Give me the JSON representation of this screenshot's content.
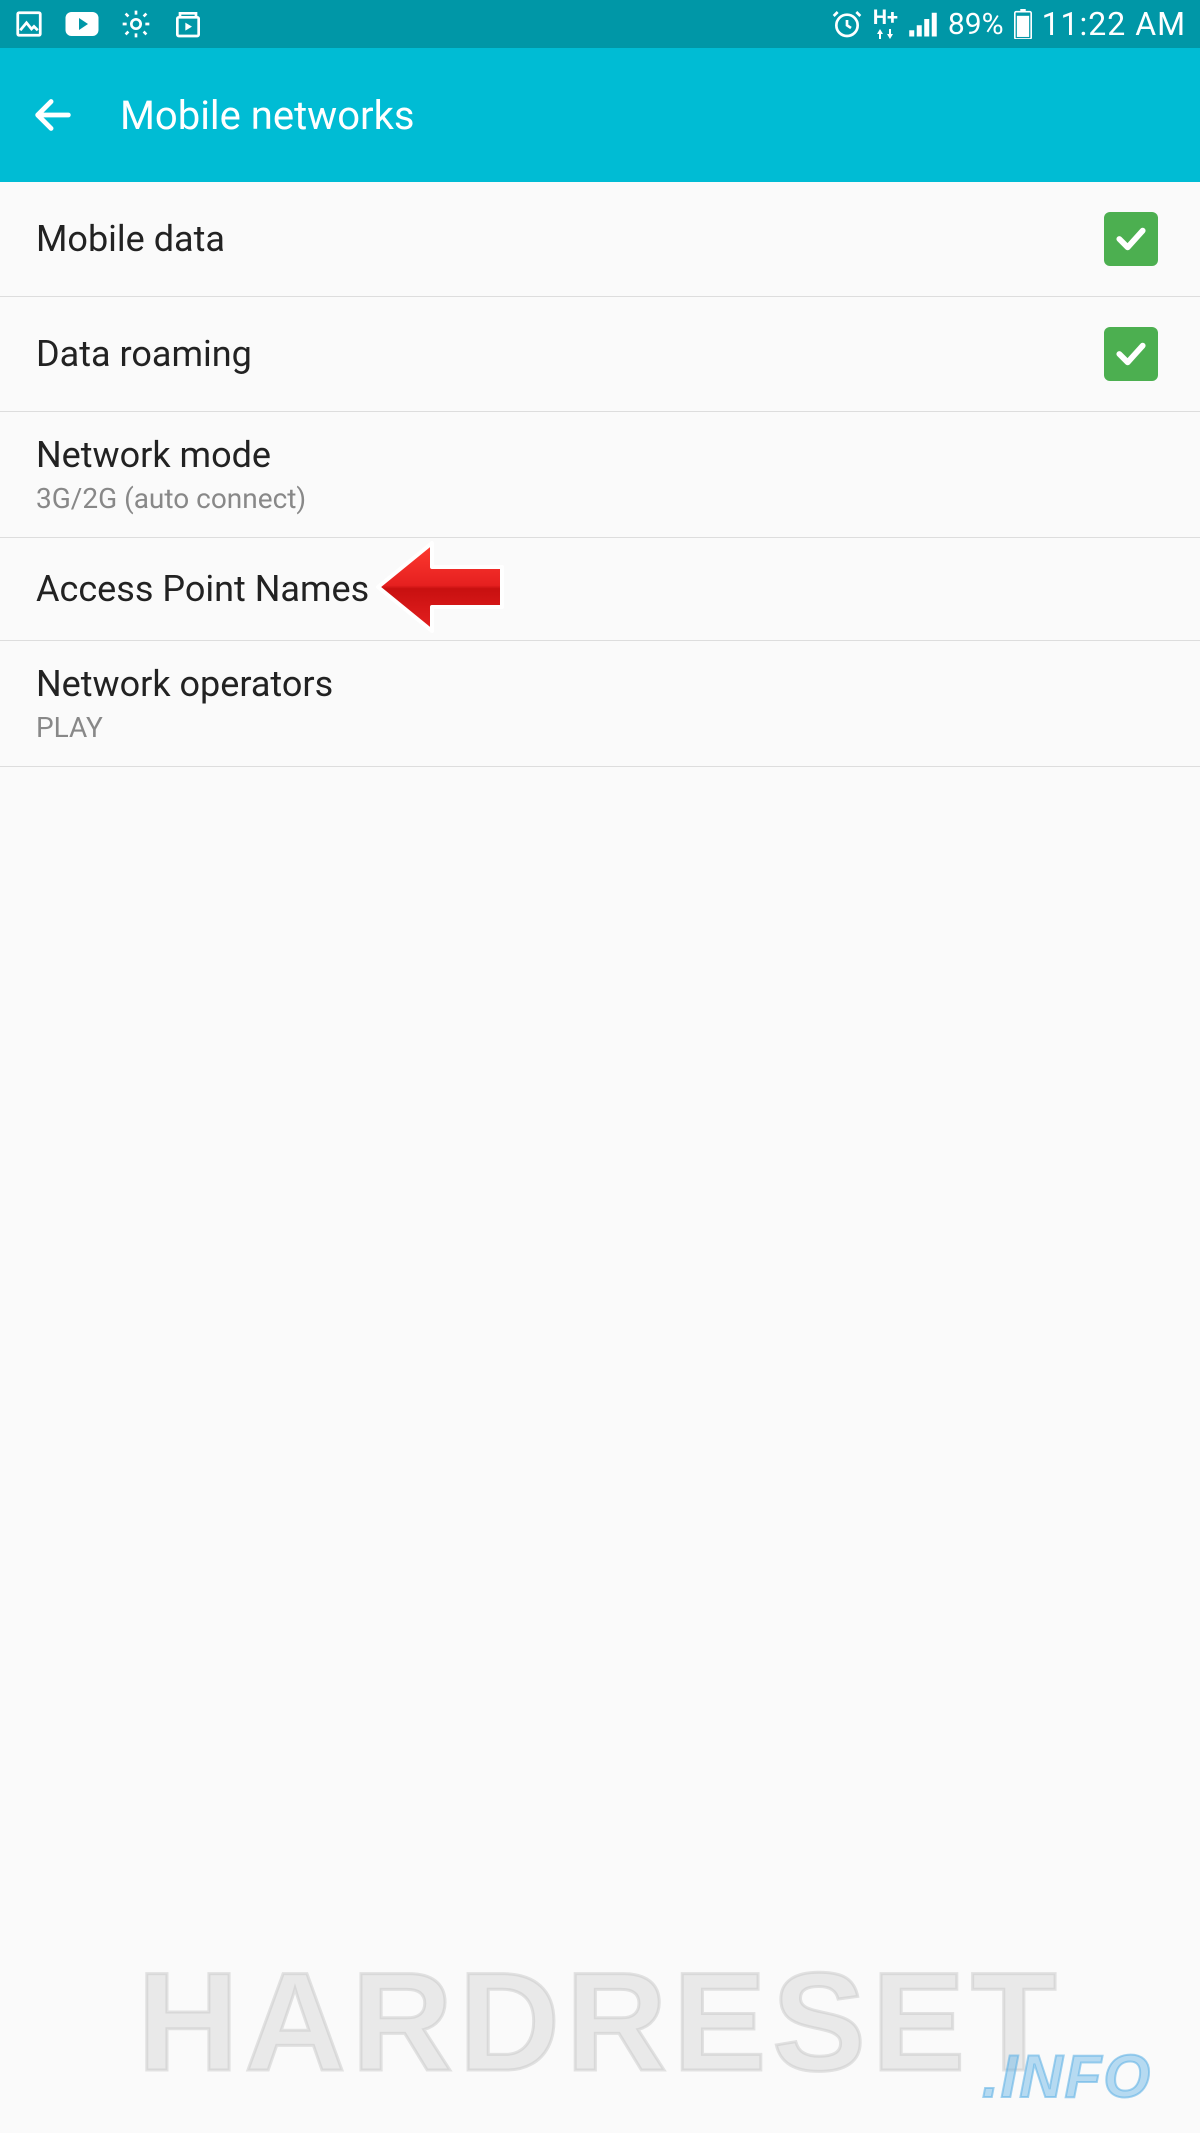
{
  "status_bar": {
    "battery_percent": "89%",
    "time": "11:22 AM",
    "data_mode": "H+"
  },
  "header": {
    "title": "Mobile networks"
  },
  "settings": [
    {
      "label": "Mobile data",
      "checked": true
    },
    {
      "label": "Data roaming",
      "checked": true
    },
    {
      "label": "Network mode",
      "sublabel": "3G/2G (auto connect)"
    },
    {
      "label": "Access Point Names",
      "highlighted": true
    },
    {
      "label": "Network operators",
      "sublabel": "PLAY"
    }
  ],
  "watermark": {
    "main": "HARDRESET",
    "sub": ".INFO"
  }
}
